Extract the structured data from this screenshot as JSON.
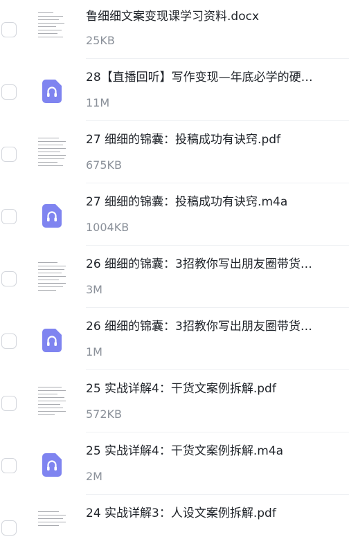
{
  "files": [
    {
      "name": "鲁细细文案变现课学习资料.docx",
      "size": "25KB",
      "type": "document"
    },
    {
      "name": "28【直播回听】写作变现—年底必学的硬…",
      "size": "11M",
      "type": "audio"
    },
    {
      "name": "27 细细的锦囊：投稿成功有诀窍.pdf",
      "size": "675KB",
      "type": "document"
    },
    {
      "name": "27 细细的锦囊：投稿成功有诀窍.m4a",
      "size": "1004KB",
      "type": "audio"
    },
    {
      "name": "26 细细的锦囊：3招教你写出朋友圈带货…",
      "size": "3M",
      "type": "document"
    },
    {
      "name": "26 细细的锦囊：3招教你写出朋友圈带货…",
      "size": "1M",
      "type": "audio"
    },
    {
      "name": "25 实战详解4：干货文案例拆解.pdf",
      "size": "572KB",
      "type": "document"
    },
    {
      "name": "25 实战详解4：干货文案例拆解.m4a",
      "size": "2M",
      "type": "audio"
    },
    {
      "name": "24 实战详解3：人设文案例拆解.pdf",
      "size": "",
      "type": "document"
    }
  ],
  "colors": {
    "audio_icon": "#7f84f0",
    "text": "#1f2329",
    "muted": "#8a9099"
  },
  "icons": {
    "audio": "headphones-icon",
    "document": "document-thumbnail"
  }
}
